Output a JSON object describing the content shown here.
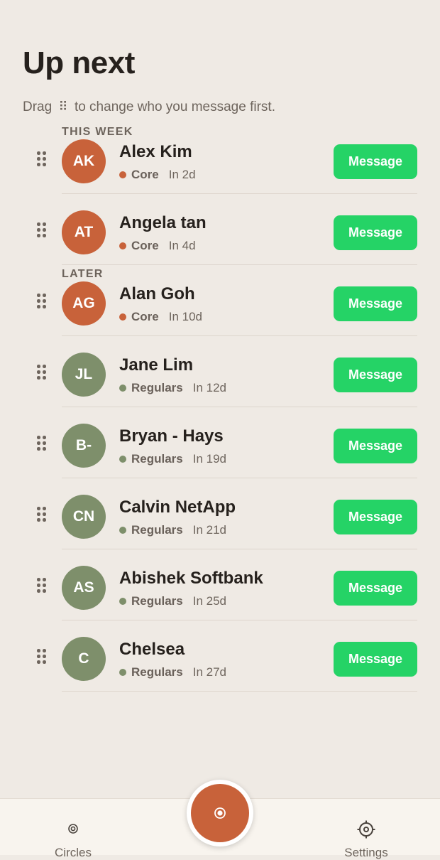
{
  "page": {
    "title": "Up next",
    "hint_before": "Drag",
    "hint_icon": "⠿",
    "hint_after": "to change who you message first."
  },
  "sections": {
    "this_week": "THIS WEEK",
    "later": "LATER"
  },
  "colors": {
    "core": "#c8623a",
    "regulars": "#7e8f6b",
    "message_button": "#25d366"
  },
  "contacts": [
    {
      "initials": "AK",
      "name": "Alex Kim",
      "circle": "Core",
      "due": "In 2d",
      "action": "Message"
    },
    {
      "initials": "AT",
      "name": "Angela tan",
      "circle": "Core",
      "due": "In 4d",
      "action": "Message"
    },
    {
      "initials": "AG",
      "name": "Alan Goh",
      "circle": "Core",
      "due": "In 10d",
      "action": "Message"
    },
    {
      "initials": "JL",
      "name": "Jane Lim",
      "circle": "Regulars",
      "due": "In 12d",
      "action": "Message"
    },
    {
      "initials": "B-",
      "name": "Bryan - Hays",
      "circle": "Regulars",
      "due": "In 19d",
      "action": "Message"
    },
    {
      "initials": "CN",
      "name": "Calvin NetApp",
      "circle": "Regulars",
      "due": "In 21d",
      "action": "Message"
    },
    {
      "initials": "AS",
      "name": "Abishek Softbank",
      "circle": "Regulars",
      "due": "In 25d",
      "action": "Message"
    },
    {
      "initials": "C",
      "name": "Chelsea",
      "circle": "Regulars",
      "due": "In 27d",
      "action": "Message"
    }
  ],
  "nav": {
    "circles_label": "Circles",
    "circles_icon": "circles-icon",
    "settings_label": "Settings",
    "settings_icon": "gear-icon",
    "fab_icon": "record-icon"
  }
}
